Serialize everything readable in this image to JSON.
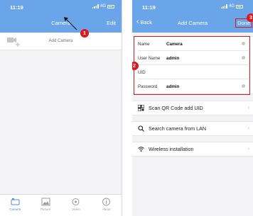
{
  "left_screen": {
    "status": {
      "time": "11:19",
      "network": "4G"
    },
    "nav": {
      "title": "Camera",
      "edit_label": "Edit"
    },
    "add_camera_label": "Add Camera",
    "step_badge": "1",
    "tabs": [
      {
        "label": "Camera",
        "icon": "camera-tab-icon",
        "active": true
      },
      {
        "label": "Picture",
        "icon": "picture-tab-icon",
        "active": false
      },
      {
        "label": "Video",
        "icon": "video-tab-icon",
        "active": false
      },
      {
        "label": "About",
        "icon": "info-tab-icon",
        "active": false
      }
    ]
  },
  "right_screen": {
    "status": {
      "time": "11:19",
      "network": "4G"
    },
    "nav": {
      "back_label": "Back",
      "title": "Add Camera",
      "done_label": "Done"
    },
    "form": {
      "name": {
        "label": "Name",
        "value": "Camera"
      },
      "user_name": {
        "label": "User Name",
        "value": "admin"
      },
      "uid": {
        "label": "UID",
        "value": ""
      },
      "password": {
        "label": "Password",
        "value": "admin"
      }
    },
    "step_badge": "2",
    "done_badge": "3",
    "options": {
      "scan_qr": "Scan QR Code add UID",
      "search_lan": "Search camera from LAN",
      "wireless": "Wireless installation"
    }
  },
  "colors": {
    "header_blue": "#6aa5ea",
    "annotation_red": "#e0161e",
    "active_tab": "#4a8fe0"
  }
}
